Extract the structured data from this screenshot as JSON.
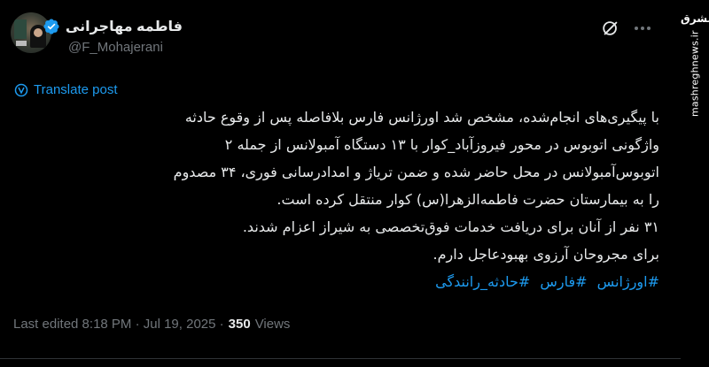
{
  "author": {
    "name": "فاطمه مهاجرانی",
    "handle": "@F_Mohajerani"
  },
  "watermark": {
    "logo": "مشرق",
    "url": "mashreghnews.ir"
  },
  "translate_label": "Translate post",
  "body_lines": [
    "با پیگیری‌های انجام‌شده، مشخص شد اورژانس فارس بلافاصله پس از وقوع حادثه",
    "واژگونی اتوبوس در محور فیروزآباد_کوار با ۱۳ دستگاه آمبولانس از جمله ۲",
    "اتوبوس‌آمبولانس در محل حاضر شده و ضمن تریاژ و امدادرسانی فوری، ۳۴ مصدوم",
    "را به بیمارستان حضرت فاطمه‌الزهرا(س) کوار منتقل کرده است.",
    "۳۱ نفر از آنان برای دریافت خدمات فوق‌تخصصی به شیراز اعزام شدند.",
    "برای مجروحان آرزوی بهبودعاجل دارم."
  ],
  "hashtags": [
    "#اورژانس",
    "#فارس",
    "#حادثه_رانندگی"
  ],
  "meta": {
    "edited": "Last edited 8:18 PM · Jul 19, 2025 ·",
    "views_count": "350",
    "views_label": "Views"
  },
  "colors": {
    "background": "#000000",
    "text": "#e7e9ea",
    "secondary": "#71767b",
    "accent": "#1d9bf0"
  },
  "icons": {
    "verified": "verified-badge-icon",
    "grok": "grok-icon",
    "more": "more-icon",
    "translate": "translate-icon"
  }
}
